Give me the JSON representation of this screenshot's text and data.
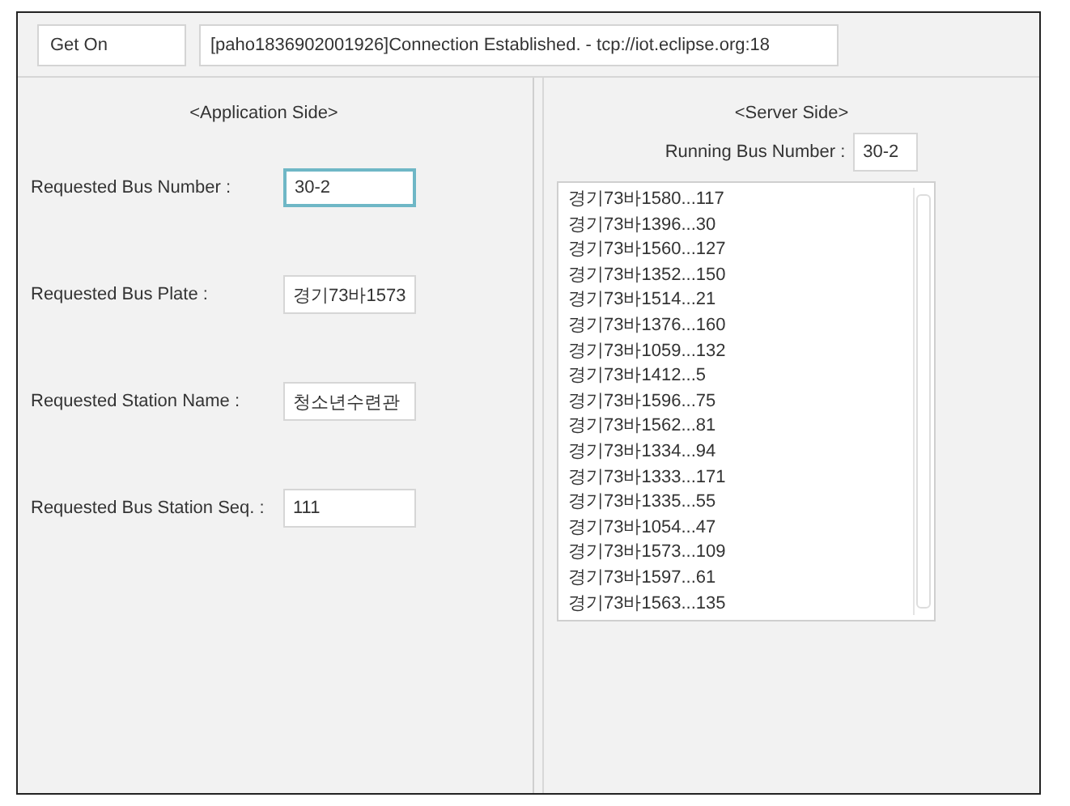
{
  "toolbar": {
    "button": "Get On",
    "status": "[paho1836902001926]Connection Established. - tcp://iot.eclipse.org:18"
  },
  "application_side": {
    "title": "<Application Side>",
    "fields": [
      {
        "label": "Requested Bus Number :",
        "value": "30-2",
        "focused": true
      },
      {
        "label": "Requested Bus Plate :",
        "value": "경기73바1573",
        "focused": false
      },
      {
        "label": "Requested Station Name :",
        "value": "청소년수련관",
        "focused": false
      },
      {
        "label": "Requested Bus Station Seq. :",
        "value": "111",
        "focused": false
      }
    ]
  },
  "server_side": {
    "title": "<Server Side>",
    "running_label": "Running Bus Number :",
    "running_value": "30-2",
    "list": [
      "경기73바1580...117",
      "경기73바1396...30",
      "경기73바1560...127",
      "경기73바1352...150",
      "경기73바1514...21",
      "경기73바1376...160",
      "경기73바1059...132",
      "경기73바1412...5",
      "경기73바1596...75",
      "경기73바1562...81",
      "경기73바1334...94",
      "경기73바1333...171",
      "경기73바1335...55",
      "경기73바1054...47",
      "경기73바1573...109",
      "경기73바1597...61",
      "경기73바1563...135"
    ]
  }
}
